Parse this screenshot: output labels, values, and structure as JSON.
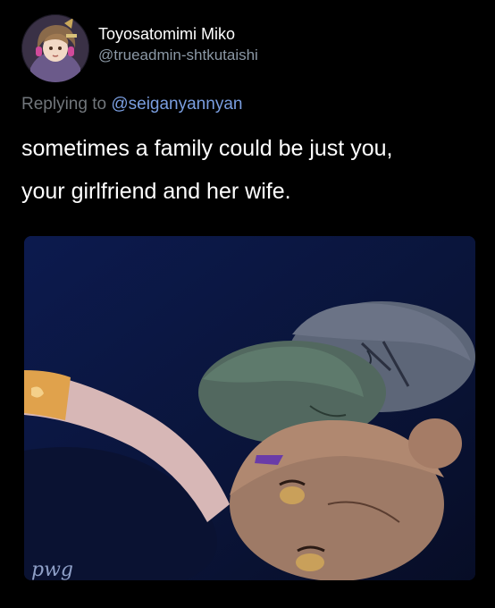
{
  "tweet": {
    "author": {
      "display_name": "Toyosatomimi Miko",
      "handle": "@trueadmin-shtkutaishi",
      "avatar_icon": "profile-avatar"
    },
    "reply": {
      "prefix": "Replying to",
      "mention": "@seiganyannyan"
    },
    "text_lines": [
      "sometimes a family could be just you,",
      "your girlfriend and her wife."
    ],
    "media": {
      "type": "drawing",
      "signature": "pwg"
    }
  },
  "colors": {
    "background": "#000000",
    "text": "#ffffff",
    "secondary": "#8b98a5",
    "link": "#7a9ee0"
  }
}
